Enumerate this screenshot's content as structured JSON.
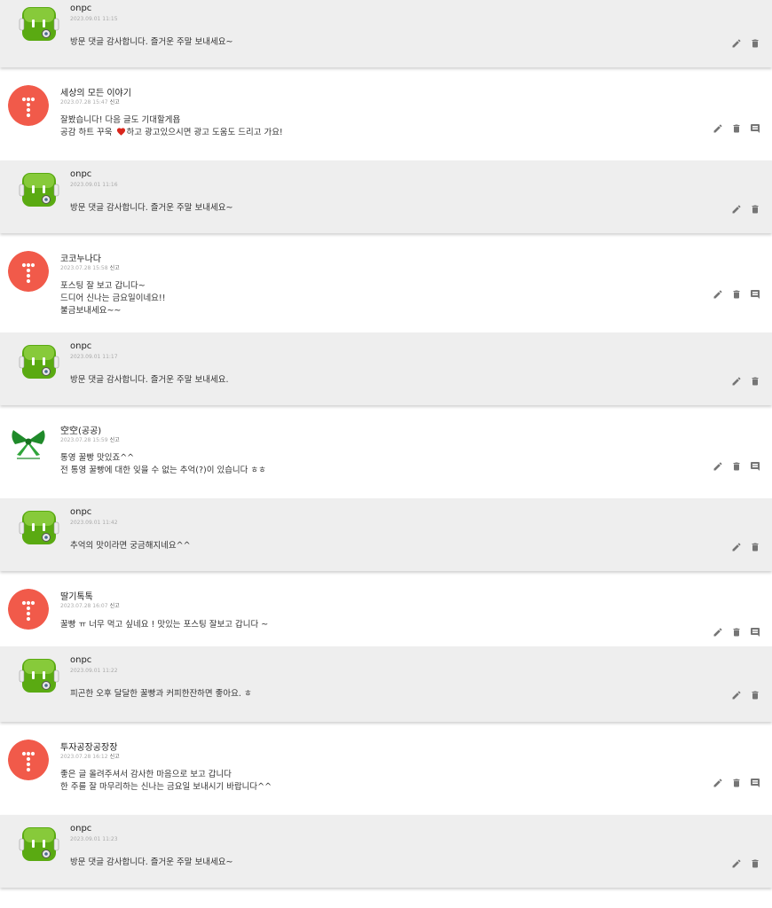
{
  "report_label": "신고",
  "colors": {
    "reply_bg": "#eeeeee",
    "avatar_red": "#f15a4a",
    "robot_green": "#5aaa12",
    "heart": "#d9261c",
    "icon_gray": "#757575"
  },
  "icons": {
    "edit": "pencil-icon",
    "delete": "trash-icon",
    "reply": "comment-icon"
  },
  "comments": [
    {
      "type": "reply",
      "author": "onpc",
      "date": "2023.09.01 11:15",
      "lines": [
        "방문 댓글 감사합니다. 즐거운 주말 보내세요~"
      ]
    },
    {
      "type": "top",
      "avatar": "dots",
      "author": "세상의 모든 이야기",
      "date": "2023.07.28 15:47",
      "lines": [
        "잘봤습니다! 다음 글도 기대할게욥",
        "공감 하트 꾸욱",
        "하고 광고있으시면 광고 도움도 드리고 가요!"
      ]
    },
    {
      "type": "reply",
      "author": "onpc",
      "date": "2023.09.01 11:16",
      "lines": [
        "방문 댓글 감사합니다. 즐거운 주말 보내세요~"
      ]
    },
    {
      "type": "top",
      "avatar": "dots",
      "author": "코코누나다",
      "date": "2023.07.28 15:58",
      "lines": [
        "포스팅 잘 보고 갑니다~",
        "드디어 신나는 금요일이네요!!",
        "불금보내세요~~"
      ]
    },
    {
      "type": "reply",
      "author": "onpc",
      "date": "2023.09.01 11:17",
      "lines": [
        "방문 댓글 감사합니다. 즐거운 주말 보내세요."
      ]
    },
    {
      "type": "top",
      "avatar": "ribbon",
      "author": "空空(공공)",
      "date": "2023.07.28 15:59",
      "lines": [
        "통영 꿀빵 맛있죠^^",
        "전 통영 꿀빵에 대한 잊을 수 없는 추억(?)이 있습니다 ㅎㅎ"
      ]
    },
    {
      "type": "reply",
      "author": "onpc",
      "date": "2023.09.01 11:42",
      "lines": [
        "추억의 맛이라면 궁금해지네요^^"
      ]
    },
    {
      "type": "top",
      "avatar": "dots",
      "author": "딸기톡톡",
      "date": "2023.07.28 16:07",
      "lines": [
        "꿀빵 ㅠ 너무 먹고 싶네요 ! 맛있는 포스팅 잘보고 갑니다 ~"
      ]
    },
    {
      "type": "reply",
      "author": "onpc",
      "date": "2023.09.01 11:22",
      "lines": [
        "피곤한 오후 달달한 꿀빵과 커피한잔하면 좋아요. ㅎ"
      ]
    },
    {
      "type": "top",
      "avatar": "dots",
      "author": "투자공장공장장",
      "date": "2023.07.28 16:12",
      "lines": [
        "좋은 글 올려주셔서 감사한 마음으로 보고 갑니다",
        "한 주를 잘 마무리하는 신나는 금요일 보내시기 바랍니다^^"
      ]
    },
    {
      "type": "reply",
      "author": "onpc",
      "date": "2023.09.01 11:23",
      "lines": [
        "방문 댓글 감사합니다. 즐거운 주말 보내세요~"
      ]
    }
  ]
}
